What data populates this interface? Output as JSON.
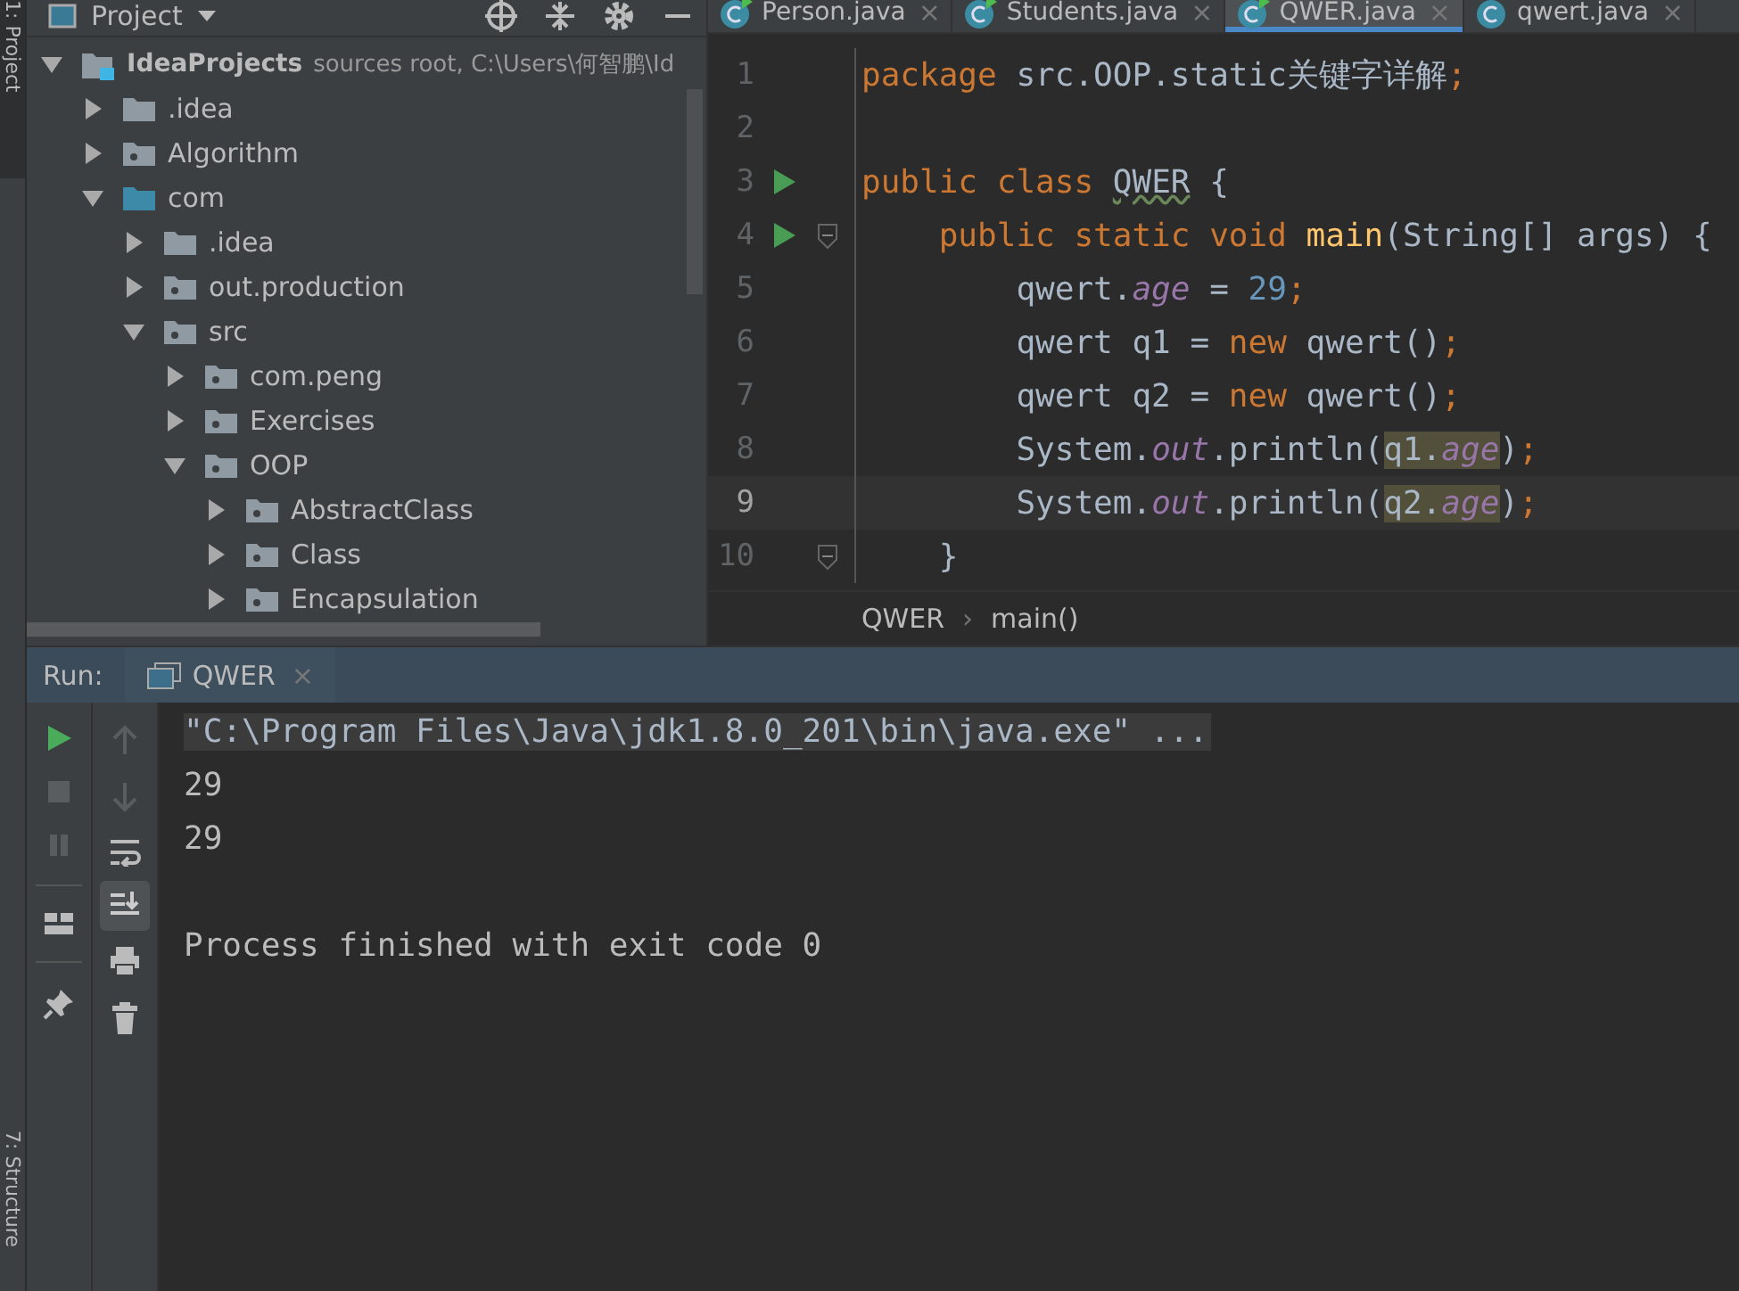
{
  "side_stripe": {
    "top_label": "1: Project",
    "bottom_label": "7: Structure"
  },
  "project_panel": {
    "title": "Project",
    "tree": [
      {
        "label": "IdeaProjects",
        "hint": "sources root,  C:\\Users\\何智鹏\\Id",
        "kind": "root",
        "expanded": true,
        "children": [
          {
            "label": ".idea",
            "kind": "folder",
            "expanded": false
          },
          {
            "label": "Algorithm",
            "kind": "module",
            "expanded": false
          },
          {
            "label": "com",
            "kind": "source",
            "expanded": true,
            "children": [
              {
                "label": ".idea",
                "kind": "folder",
                "expanded": false
              },
              {
                "label": "out.production",
                "kind": "module",
                "expanded": false
              },
              {
                "label": "src",
                "kind": "module",
                "expanded": true,
                "children": [
                  {
                    "label": "com.peng",
                    "kind": "module",
                    "expanded": false
                  },
                  {
                    "label": "Exercises",
                    "kind": "module",
                    "expanded": false
                  },
                  {
                    "label": "OOP",
                    "kind": "module",
                    "expanded": true,
                    "children": [
                      {
                        "label": "AbstractClass",
                        "kind": "module",
                        "expanded": false
                      },
                      {
                        "label": "Class",
                        "kind": "module",
                        "expanded": false
                      },
                      {
                        "label": "Encapsulation",
                        "kind": "module",
                        "expanded": false
                      }
                    ]
                  }
                ]
              }
            ]
          }
        ]
      }
    ]
  },
  "editor": {
    "tabs": [
      {
        "label": "Person.java",
        "runnable": true,
        "selected": false,
        "close": "×"
      },
      {
        "label": "Students.java",
        "runnable": true,
        "selected": false,
        "close": "×"
      },
      {
        "label": "QWER.java",
        "runnable": true,
        "selected": true,
        "close": "×"
      },
      {
        "label": "qwert.java",
        "runnable": false,
        "selected": false,
        "close": "×"
      }
    ],
    "lines": [
      {
        "number": "1",
        "run": false,
        "fold": false,
        "current": false,
        "tokens": [
          {
            "text": "package ",
            "kind": "keyword"
          },
          {
            "text": "src.OOP.static关键字详解",
            "kind": "plain"
          },
          {
            "text": ";",
            "kind": "keyword"
          }
        ]
      },
      {
        "number": "2",
        "run": false,
        "fold": false,
        "current": false
      },
      {
        "number": "3",
        "run": true,
        "fold": false,
        "current": false,
        "tokens": [
          {
            "text": "public class ",
            "kind": "keyword"
          },
          {
            "text": "QWER",
            "kind": "warning"
          },
          {
            "text": " {",
            "kind": "plain"
          }
        ]
      },
      {
        "number": "4",
        "run": true,
        "fold": true,
        "current": false,
        "tokens": [
          {
            "text": "    public static void ",
            "kind": "keyword"
          },
          {
            "text": "main",
            "kind": "method"
          },
          {
            "text": "(String[] args) {",
            "kind": "plain"
          }
        ]
      },
      {
        "number": "5",
        "run": false,
        "fold": false,
        "current": false,
        "tokens": [
          {
            "text": "        qwert.",
            "kind": "plain"
          },
          {
            "text": "age",
            "kind": "field"
          },
          {
            "text": " = ",
            "kind": "plain"
          },
          {
            "text": "29",
            "kind": "number"
          },
          {
            "text": ";",
            "kind": "keyword"
          }
        ]
      },
      {
        "number": "6",
        "run": false,
        "fold": false,
        "current": false,
        "tokens": [
          {
            "text": "        qwert q1 = ",
            "kind": "plain"
          },
          {
            "text": "new ",
            "kind": "keyword"
          },
          {
            "text": "qwert()",
            "kind": "plain"
          },
          {
            "text": ";",
            "kind": "keyword"
          }
        ]
      },
      {
        "number": "7",
        "run": false,
        "fold": false,
        "current": false,
        "tokens": [
          {
            "text": "        qwert q2 = ",
            "kind": "plain"
          },
          {
            "text": "new ",
            "kind": "keyword"
          },
          {
            "text": "qwert()",
            "kind": "plain"
          },
          {
            "text": ";",
            "kind": "keyword"
          }
        ]
      },
      {
        "number": "8",
        "run": false,
        "fold": false,
        "current": false,
        "tokens": [
          {
            "text": "        System.",
            "kind": "plain"
          },
          {
            "text": "out",
            "kind": "field"
          },
          {
            "text": ".println(",
            "kind": "plain"
          },
          {
            "text": "q1.",
            "kind": "usage"
          },
          {
            "text": "age",
            "kind": "usage_field"
          },
          {
            "text": ")",
            "kind": "plain"
          },
          {
            "text": ";",
            "kind": "keyword"
          }
        ]
      },
      {
        "number": "9",
        "run": false,
        "fold": false,
        "current": true,
        "tokens": [
          {
            "text": "        System.",
            "kind": "plain"
          },
          {
            "text": "out",
            "kind": "field"
          },
          {
            "text": ".println(",
            "kind": "plain"
          },
          {
            "text": "q2.",
            "kind": "usage"
          },
          {
            "text": "age",
            "kind": "usage_field"
          },
          {
            "text": ")",
            "kind": "plain"
          },
          {
            "text": ";",
            "kind": "keyword"
          }
        ]
      },
      {
        "number": "10",
        "run": false,
        "fold": true,
        "current": false,
        "tokens": [
          {
            "text": "    }",
            "kind": "plain"
          }
        ]
      }
    ],
    "breadcrumb": [
      "QWER",
      "main()"
    ],
    "breadcrumb_separator": "›"
  },
  "run_panel": {
    "label": "Run:",
    "tab": {
      "label": "QWER",
      "close": "×"
    },
    "console": [
      {
        "text": "\"C:\\Program Files\\Java\\jdk1.8.0_201\\bin\\java.exe\" ...",
        "kind": "command"
      },
      {
        "text": "29",
        "kind": "output"
      },
      {
        "text": "29",
        "kind": "output"
      },
      {
        "kind": "blank"
      },
      {
        "text": "Process finished with exit code 0",
        "kind": "output"
      }
    ]
  }
}
